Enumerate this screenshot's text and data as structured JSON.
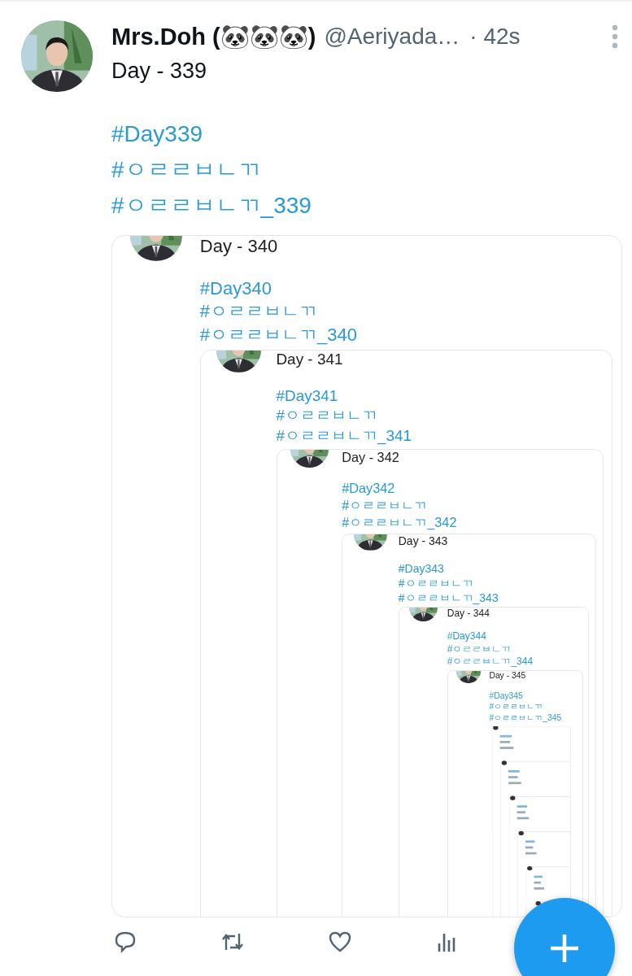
{
  "tweet": {
    "author": {
      "name": "Mrs.Doh (🐼🐼🐼)",
      "handle": "@Aeriyada…",
      "time": "· 42s"
    },
    "text": "Day - 339",
    "hashtags": [
      "#Day339",
      "#ㅇㄹㄹㅂㄴㄲ",
      "#ㅇㄹㄹㅂㄴㄲ_339"
    ],
    "quoted": {
      "text": "Day - 340",
      "hashtags": [
        "#Day340",
        "#ㅇㄹㄹㅂㄴㄲ",
        "#ㅇㄹㄹㅂㄴㄲ_340"
      ],
      "quoted": {
        "text": "Day - 341",
        "hashtags": [
          "#Day341",
          "#ㅇㄹㄹㅂㄴㄲ",
          "#ㅇㄹㄹㅂㄴㄲ_341"
        ],
        "quoted": {
          "text": "Day - 342",
          "hashtags": [
            "#Day342",
            "#ㅇㄹㄹㅂㄴㄲ",
            "#ㅇㄹㄹㅂㄴㄲ_342"
          ],
          "quoted": {
            "text": "Day - 343",
            "hashtags": [
              "#Day343",
              "#ㅇㄹㄹㅂㄴㄲ",
              "#ㅇㄹㄹㅂㄴㄲ_343"
            ],
            "quoted": {
              "text": "Day - 344",
              "hashtags": [
                "#Day344",
                "#ㅇㄹㄹㅂㄴㄲ",
                "#ㅇㄹㄹㅂㄴㄲ_344"
              ],
              "quoted": {
                "text": "Day - 345",
                "hashtags": [
                  "#Day345",
                  "#ㅇㄹㄹㅂㄴㄲ",
                  "#ㅇㄹㄹㅂㄴㄲ_345"
                ]
              }
            }
          }
        }
      }
    }
  },
  "actions": [
    {
      "kind": "reply"
    },
    {
      "kind": "retweet"
    },
    {
      "kind": "like"
    },
    {
      "kind": "views"
    }
  ]
}
